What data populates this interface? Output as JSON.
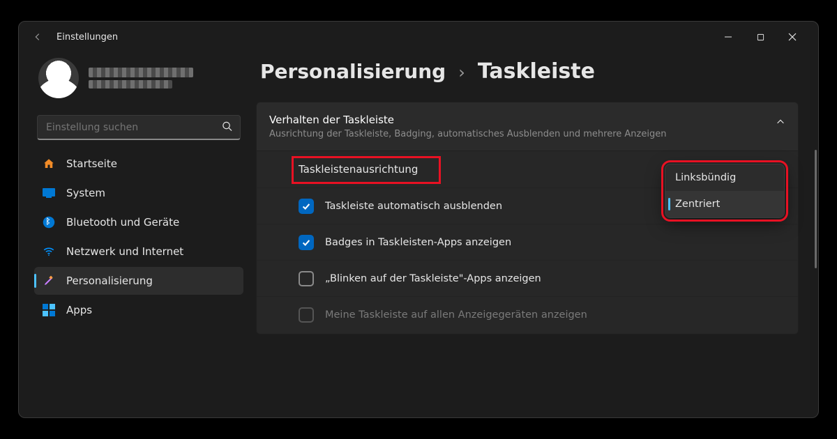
{
  "titlebar": {
    "title": "Einstellungen"
  },
  "search": {
    "placeholder": "Einstellung suchen"
  },
  "sidebar": {
    "items": [
      {
        "label": "Startseite"
      },
      {
        "label": "System"
      },
      {
        "label": "Bluetooth und Geräte"
      },
      {
        "label": "Netzwerk und Internet"
      },
      {
        "label": "Personalisierung"
      },
      {
        "label": "Apps"
      }
    ]
  },
  "breadcrumb": {
    "parent": "Personalisierung",
    "sep": "›",
    "current": "Taskleiste"
  },
  "card": {
    "title": "Verhalten der Taskleiste",
    "subtitle": "Ausrichtung der Taskleiste, Badging, automatisches Ausblenden und mehrere Anzeigen"
  },
  "rows": {
    "alignment_label": "Taskleistenausrichtung",
    "auto_hide": "Taskleiste automatisch ausblenden",
    "badges": "Badges in Taskleisten-Apps anzeigen",
    "flashing": "„Blinken auf der Taskleiste\"-Apps anzeigen",
    "all_displays": "Meine Taskleiste auf allen Anzeigegeräten anzeigen"
  },
  "dropdown": {
    "options": [
      {
        "label": "Linksbündig",
        "selected": false
      },
      {
        "label": "Zentriert",
        "selected": true
      }
    ]
  },
  "colors": {
    "accent": "#4cc2ff",
    "checkbox_on": "#0067c0",
    "highlight": "#e81123"
  }
}
